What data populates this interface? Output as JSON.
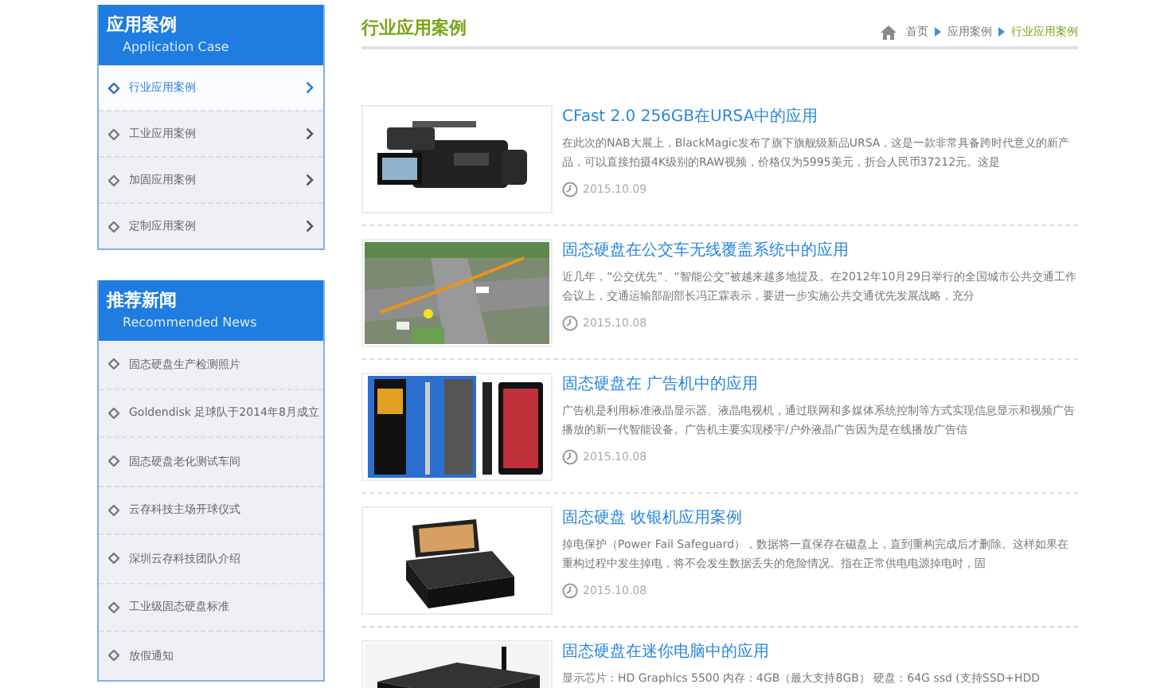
{
  "sidebar": [
    {
      "title": "应用案例",
      "subtitle": "Application Case",
      "items": [
        {
          "label": "行业应用案例",
          "selected": true
        },
        {
          "label": "工业应用案例",
          "selected": false
        },
        {
          "label": "加固应用案例",
          "selected": false
        },
        {
          "label": "定制应用案例",
          "selected": false
        }
      ]
    },
    {
      "title": "推荐新闻",
      "subtitle": "Recommended News",
      "items": [
        {
          "label": "固态硬盘生产检测照片"
        },
        {
          "label": "Goldendisk 足球队于2014年8月成立"
        },
        {
          "label": "固态硬盘老化测试车间"
        },
        {
          "label": "云存科技主场开球仪式"
        },
        {
          "label": "深圳云存科技团队介绍"
        },
        {
          "label": "工业级固态硬盘标准"
        },
        {
          "label": "放假通知"
        }
      ]
    }
  ],
  "page_title": "行业应用案例",
  "breadcrumb": [
    {
      "label": "首页",
      "selected": false
    },
    {
      "label": "应用案例",
      "selected": false
    },
    {
      "label": "行业应用案例",
      "selected": true
    }
  ],
  "articles": [
    {
      "title": "CFast 2.0 256GB在URSA中的应用",
      "summary": "在此次的NAB大展上，BlackMagic发布了旗下旗舰级新品URSA，这是一款非常具备跨时代意义的新产品，可以直接拍摄4K级别的RAW视频，价格仅为5995美元，折合人民币37212元。这是",
      "date": "2015.10.09"
    },
    {
      "title": "固态硬盘在公交车无线覆盖系统中的应用",
      "summary": "近几年，“公交优先”、“智能公交”被越来越多地提及。在2012年10月29日举行的全国城市公共交通工作会议上，交通运输部副部长冯正霖表示，要进一步实施公共交通优先发展战略，充分",
      "date": "2015.10.08"
    },
    {
      "title": "固态硬盘在 广告机中的应用",
      "summary": "广告机是利用标准液晶显示器、液晶电视机，通过联网和多媒体系统控制等方式实现信息显示和视频广告播放的新一代智能设备。广告机主要实现楼宇/户外液晶广告因为是在线播放广告信",
      "date": "2015.10.08"
    },
    {
      "title": "固态硬盘 收银机应用案例",
      "summary": "掉电保护（Power Fail Safeguard），数据将一直保存在磁盘上，直到重构完成后才删除。这样如果在重构过程中发生掉电，将不会发生数据丢失的危险情况。指在正常供电电源掉电时，固",
      "date": "2015.10.08"
    },
    {
      "title": "固态硬盘在迷你电脑中的应用",
      "summary": "显示芯片：HD Graphics 5500 内存：4GB（最大支持8GB） 硬盘：64G ssd (支持SSD+HDD"
    }
  ]
}
